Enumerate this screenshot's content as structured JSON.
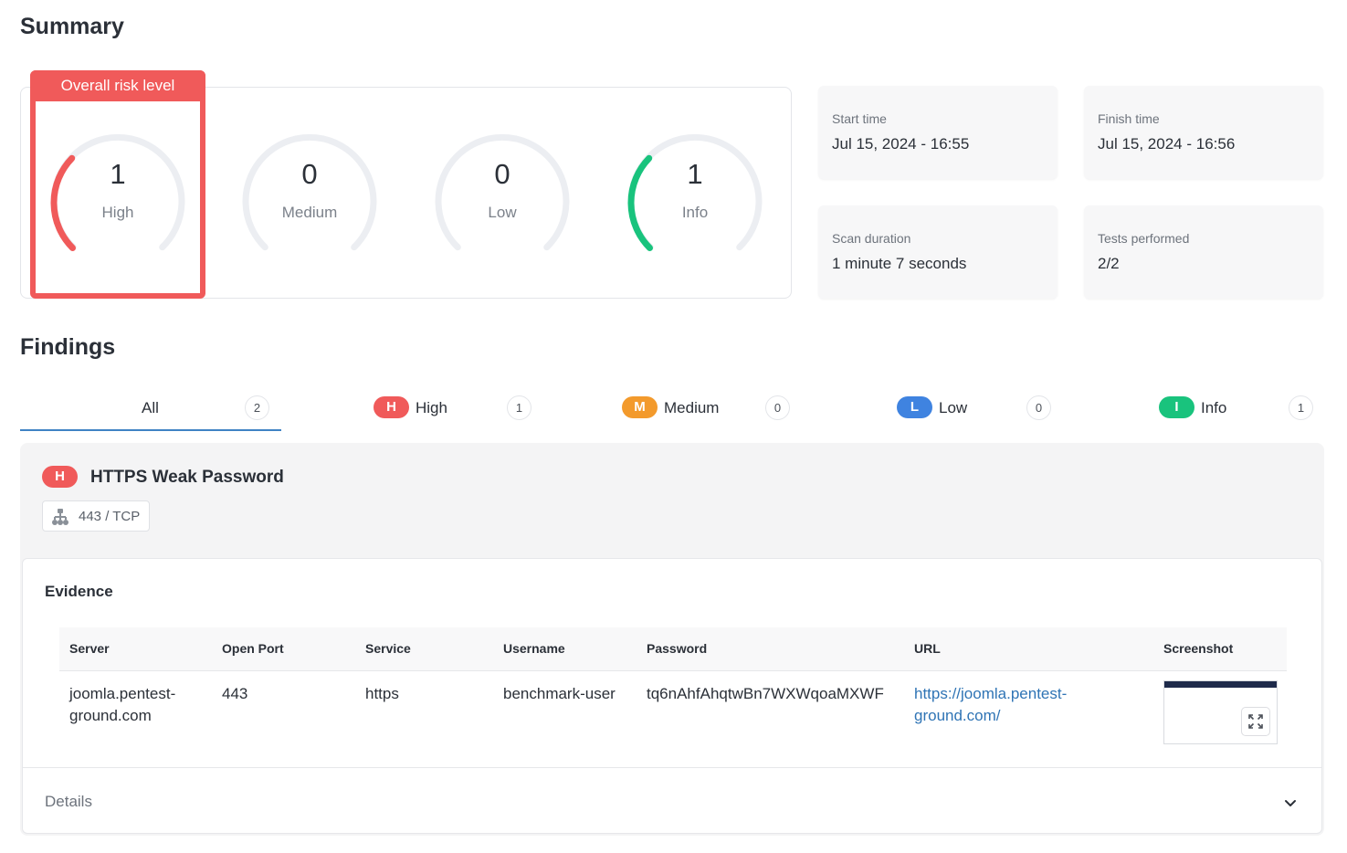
{
  "summary": {
    "title": "Summary",
    "risk_level_label": "Overall risk level",
    "gauges": [
      {
        "value": "1",
        "label": "High",
        "fill": 0.33,
        "color": "#f05a5a"
      },
      {
        "value": "0",
        "label": "Medium",
        "fill": 0,
        "color": "#f39a2c"
      },
      {
        "value": "0",
        "label": "Low",
        "fill": 0,
        "color": "#3f83e0"
      },
      {
        "value": "1",
        "label": "Info",
        "fill": 0.33,
        "color": "#19c37d"
      }
    ],
    "cards": [
      {
        "label": "Start time",
        "value": "Jul 15, 2024 - 16:55"
      },
      {
        "label": "Finish time",
        "value": "Jul 15, 2024 - 16:56"
      },
      {
        "label": "Scan duration",
        "value": "1 minute 7 seconds"
      },
      {
        "label": "Tests performed",
        "value": "2/2"
      }
    ]
  },
  "findings": {
    "title": "Findings",
    "tabs": [
      {
        "label": "All",
        "count": "2"
      },
      {
        "badge": "H",
        "label": "High",
        "count": "1",
        "color": "#f05a5a"
      },
      {
        "badge": "M",
        "label": "Medium",
        "count": "0",
        "color": "#f39a2c"
      },
      {
        "badge": "L",
        "label": "Low",
        "count": "0",
        "color": "#3f83e0"
      },
      {
        "badge": "I",
        "label": "Info",
        "count": "1",
        "color": "#19c37d"
      }
    ],
    "item": {
      "badge": "H",
      "title": "HTTPS Weak Password",
      "port": "443 / TCP",
      "evidence_title": "Evidence",
      "columns": [
        "Server",
        "Open Port",
        "Service",
        "Username",
        "Password",
        "URL",
        "Screenshot"
      ],
      "row": {
        "server_line1": "joomla.pentest-",
        "server_line2": "ground.com",
        "port": "443",
        "service": "https",
        "username": "benchmark-user",
        "password": "tq6nAhfAhqtwBn7WXWqoaMXWF",
        "url_line1": "https://joomla.pentest-",
        "url_line2": "ground.com/"
      },
      "details_label": "Details"
    }
  },
  "icons": [
    "network-icon",
    "expand-icon",
    "chevron-down-icon"
  ]
}
